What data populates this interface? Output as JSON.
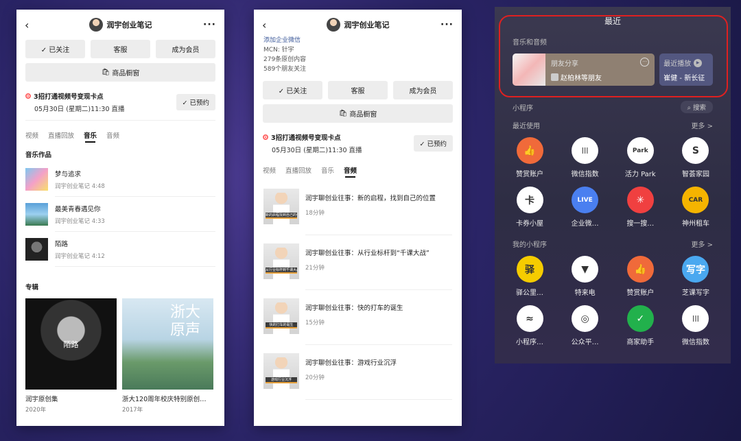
{
  "phone1": {
    "title": "润宇创业笔记",
    "follow_label": "✓ 已关注",
    "service_label": "客服",
    "member_label": "成为会员",
    "shop_label": "商品橱窗",
    "live_title": "3招打通视频号变现卡点",
    "live_time": "05月30日 (星期二)11:30 直播",
    "reserve_label": "✓ 已预约",
    "tabs": [
      "视频",
      "直播回放",
      "音乐",
      "音频"
    ],
    "active_tab": "音乐",
    "music_section": "音乐作品",
    "music": [
      {
        "name": "梦与追求",
        "sub": "润宇创业笔记 4:48"
      },
      {
        "name": "最美青春遇见你",
        "sub": "润宇创业笔记 4:33"
      },
      {
        "name": "陌路",
        "sub": "润宇创业笔记 4:12"
      }
    ],
    "album_section": "专辑",
    "albums": [
      {
        "name": "润宇原创集",
        "year": "2020年",
        "cover_text": "陌路"
      },
      {
        "name": "浙大120周年校庆特别原创…",
        "year": "2017年",
        "cover_text": "浙大原声"
      }
    ]
  },
  "phone2": {
    "title": "润宇创业笔记",
    "link": "添加企业微信",
    "mcn": "MCN: 针宇",
    "original": "279条原创内容",
    "friends": "589个朋友关注",
    "follow_label": "✓ 已关注",
    "service_label": "客服",
    "member_label": "成为会员",
    "shop_label": "商品橱窗",
    "live_title": "3招打通视频号变现卡点",
    "live_time": "05月30日 (星期二)11:30 直播",
    "reserve_label": "✓ 已预约",
    "tabs": [
      "视频",
      "直播回放",
      "音乐",
      "音频"
    ],
    "active_tab": "音频",
    "audios": [
      {
        "name": "润宇聊创业往事：新的启程，找到自己的位置",
        "sub": "18分钟",
        "cap": "新的启程找到自己的位置"
      },
      {
        "name": "润宇聊创业往事：从行业标杆到“千课大战”",
        "sub": "21分钟",
        "cap": "从行业标杆到千课大战"
      },
      {
        "name": "润宇聊创业往事：快的打车的诞生",
        "sub": "15分钟",
        "cap": "快的打车的诞生"
      },
      {
        "name": "润宇聊创业往事：游戏行业沉浮",
        "sub": "20分钟",
        "cap": "游戏行业沉浮"
      }
    ]
  },
  "panel3": {
    "title": "最近",
    "music_label": "音乐和音频",
    "card1_title": "朋友分享",
    "card1_sub": "赵柏林等朋友",
    "card2_title": "最近播放",
    "card2_sub": "崔健 - 新长征",
    "mini_label": "小程序",
    "search_label": "搜索",
    "recent_label": "最近使用",
    "more": "更多 >",
    "my_label": "我的小程序",
    "row1": [
      {
        "name": "赞赏账户",
        "icon": "thumb-icon",
        "glyph": "👍",
        "color": "#f06a3a"
      },
      {
        "name": "微信指数",
        "icon": "bars-icon",
        "glyph": "|||",
        "color": "#ffffff"
      },
      {
        "name": "活力 Park",
        "icon": "park-icon",
        "glyph": "Park",
        "color": "#ffffff"
      },
      {
        "name": "智荟家园",
        "icon": "home-icon",
        "glyph": "S",
        "color": "#ffffff"
      }
    ],
    "row2": [
      {
        "name": "卡券小屋",
        "icon": "coupon-icon",
        "glyph": "卡",
        "color": "#ffffff"
      },
      {
        "name": "企业微…",
        "icon": "live-icon",
        "glyph": "LIVE",
        "color": "#4a7ff0"
      },
      {
        "name": "搜一搜…",
        "icon": "search-star-icon",
        "glyph": "✳",
        "color": "#f04040"
      },
      {
        "name": "神州租车",
        "icon": "car-icon",
        "glyph": "CAR",
        "color": "#f5b400"
      }
    ],
    "row3": [
      {
        "name": "驿公里…",
        "icon": "yi-icon",
        "glyph": "驿",
        "color": "#f5cc00"
      },
      {
        "name": "特来电",
        "icon": "bolt-icon",
        "glyph": "▼",
        "color": "#ffffff"
      },
      {
        "name": "赞赏账户",
        "icon": "thumb-icon",
        "glyph": "👍",
        "color": "#f06a3a"
      },
      {
        "name": "芝课写字",
        "icon": "write-icon",
        "glyph": "写字",
        "color": "#4aa8f0"
      }
    ],
    "row4": [
      {
        "name": "小程序…",
        "icon": "miniprogram-icon",
        "glyph": "≈",
        "color": "#ffffff"
      },
      {
        "name": "公众平…",
        "icon": "platform-icon",
        "glyph": "◎",
        "color": "#ffffff"
      },
      {
        "name": "商家助手",
        "icon": "merchant-icon",
        "glyph": "✓",
        "color": "#22b14c"
      },
      {
        "name": "微信指数",
        "icon": "bars-icon",
        "glyph": "|||",
        "color": "#ffffff"
      }
    ]
  }
}
